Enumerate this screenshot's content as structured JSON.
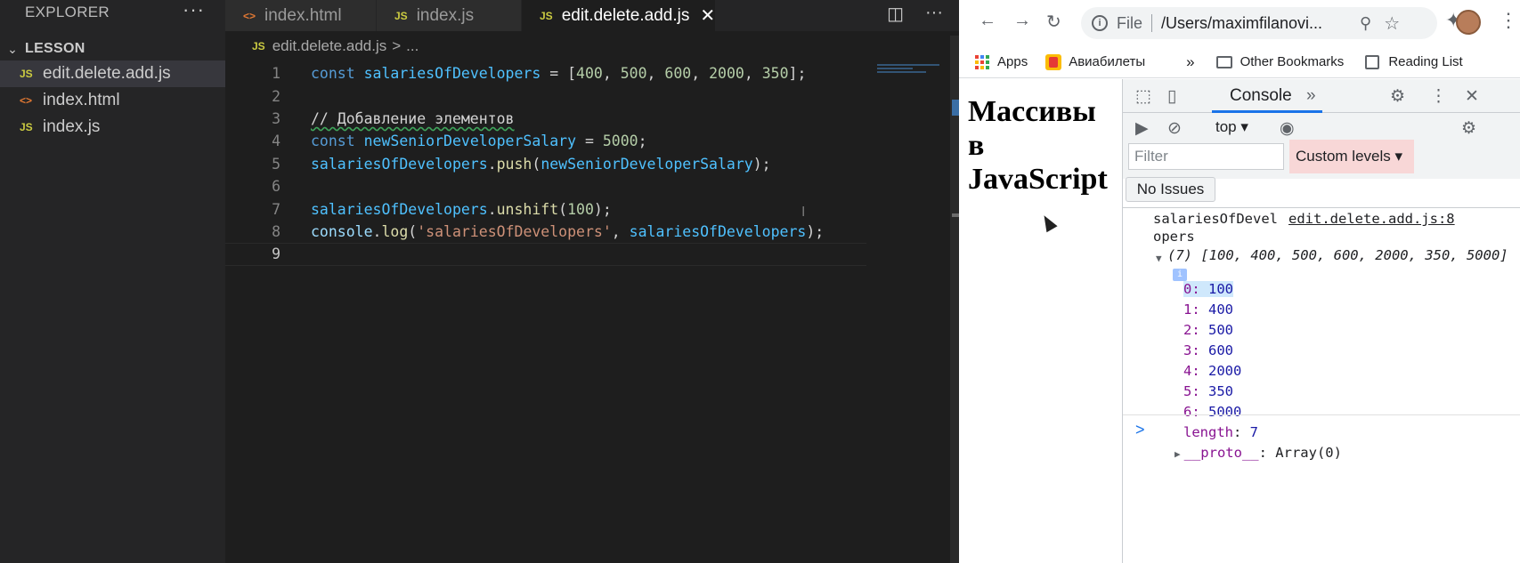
{
  "vscode": {
    "explorer_title": "EXPLORER",
    "folder": "LESSON",
    "files": [
      {
        "name": "edit.delete.add.js",
        "type": "JS"
      },
      {
        "name": "index.html",
        "type": "<>"
      },
      {
        "name": "index.js",
        "type": "JS"
      }
    ],
    "tabs": [
      {
        "label": "index.html",
        "icon": "<>"
      },
      {
        "label": "index.js",
        "icon": "JS"
      },
      {
        "label": "edit.delete.add.js",
        "icon": "JS",
        "close": "✕"
      }
    ],
    "breadcrumb": {
      "icon": "JS",
      "file": "edit.delete.add.js",
      "sep": ">",
      "rest": "..."
    },
    "line_numbers": [
      "1",
      "2",
      "3",
      "4",
      "5",
      "6",
      "7",
      "8",
      "9"
    ],
    "code": {
      "l1": {
        "kw": "const",
        "var": "salariesOfDevelopers",
        "rest_a": " = [",
        "n1": "400",
        "n2": "500",
        "n3": "600",
        "n4": "2000",
        "n5": "350",
        "rest_b": "];"
      },
      "l3": {
        "comment": "// Добавление элементов"
      },
      "l4": {
        "kw": "const",
        "var": "newSeniorDeveloperSalary",
        "eq": " = ",
        "num": "5000",
        "end": ";"
      },
      "l5": {
        "obj": "salariesOfDevelopers",
        "dot": ".",
        "fn": "push",
        "open": "(",
        "arg": "newSeniorDeveloperSalary",
        "close": ");"
      },
      "l7": {
        "obj": "salariesOfDevelopers",
        "dot": ".",
        "fn": "unshift",
        "open": "(",
        "num": "100",
        "close": ");"
      },
      "l8": {
        "obj": "console",
        "dot": ".",
        "fn": "log",
        "open": "(",
        "str": "'salariesOfDevelopers'",
        "comma": ", ",
        "arg": "salariesOfDevelopers",
        "close": ");"
      }
    }
  },
  "browser": {
    "omnibox": {
      "scheme": "File",
      "url": "/Users/maximfilanovi..."
    },
    "bookmarks": {
      "apps": "Apps",
      "aviabilety": "Авиабилеты",
      "chevron": "»",
      "other": "Other Bookmarks",
      "reading": "Reading List"
    },
    "page_heading": "Массивы в JavaScript",
    "devtools": {
      "tab": "Console",
      "chevron": "»",
      "context": "top",
      "filter_placeholder": "Filter",
      "levels": "Custom levels",
      "issues": "No Issues"
    },
    "console": {
      "msg_a": "salariesOfDevel",
      "msg_b": "opers",
      "source": "edit.delete.add.js:8",
      "array_summary": "(7) [100, 400, 500, 600, 2000, 350, 5000]",
      "info": "i",
      "items": [
        {
          "k": "0",
          "v": "100"
        },
        {
          "k": "1",
          "v": "400"
        },
        {
          "k": "2",
          "v": "500"
        },
        {
          "k": "3",
          "v": "600"
        },
        {
          "k": "4",
          "v": "2000"
        },
        {
          "k": "5",
          "v": "350"
        },
        {
          "k": "6",
          "v": "5000"
        }
      ],
      "length_key": "length",
      "length_val": "7",
      "proto_key": "__proto__",
      "proto_val": "Array(0)",
      "prompt": ">"
    }
  }
}
